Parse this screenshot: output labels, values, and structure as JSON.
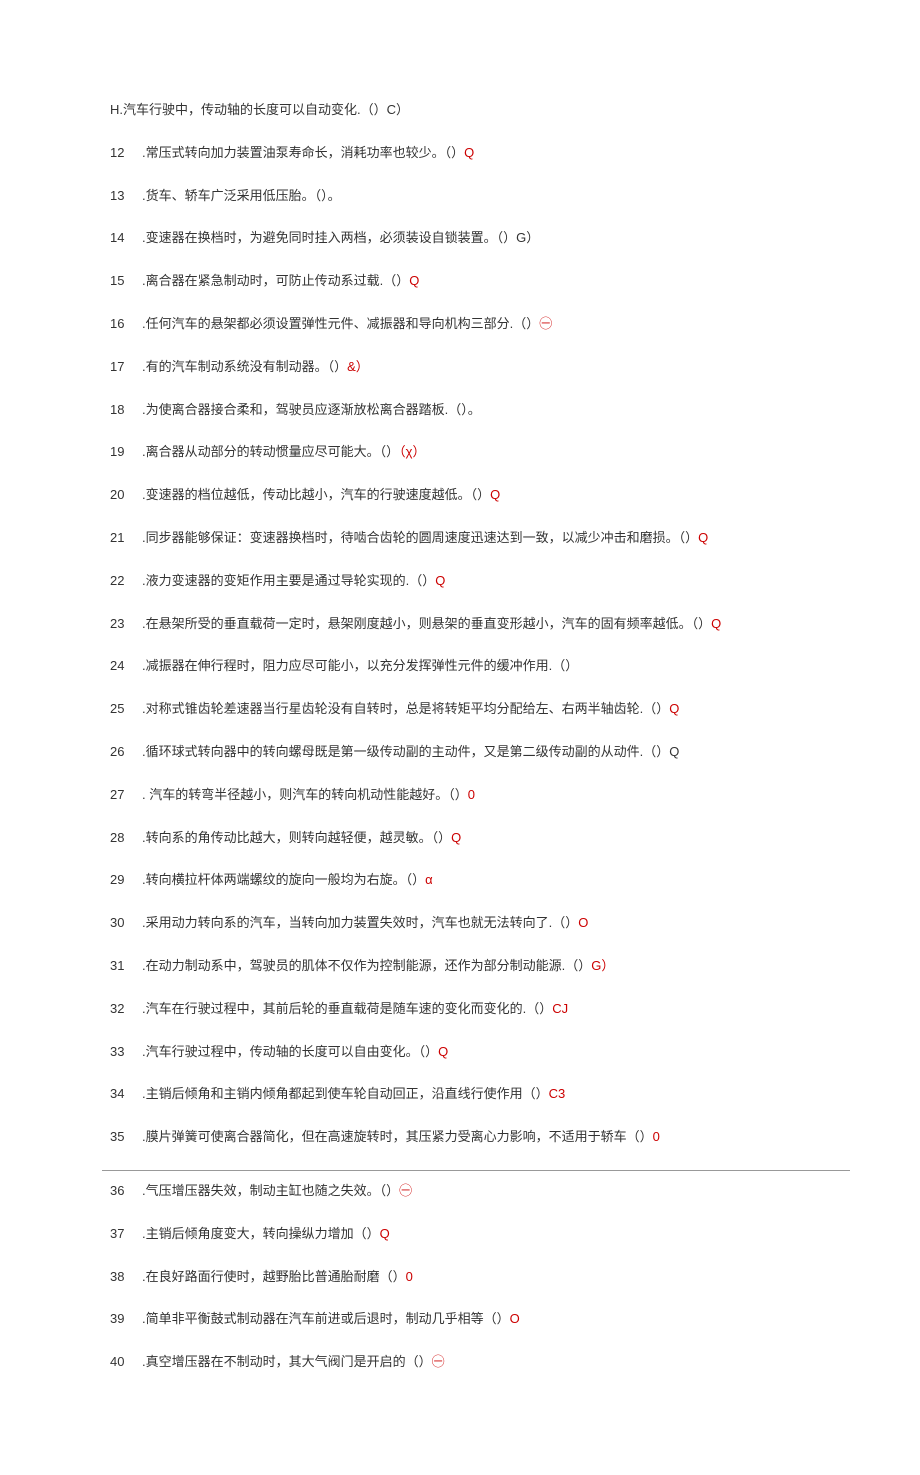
{
  "items": [
    {
      "num": "H",
      "text": ".汽车行驶中，传动轴的长度可以自动变化.（）C）",
      "mark": ""
    },
    {
      "num": "12",
      "text": ".常压式转向加力装置油泵寿命长，消耗功率也较少。（）",
      "mark": "Q"
    },
    {
      "num": "13",
      "text": ".货车、轿车广泛采用低压胎。（）。",
      "mark": ""
    },
    {
      "num": "14",
      "text": ".变速器在换档时，为避免同时挂入两档，必须装设自锁装置。（）G）",
      "mark": ""
    },
    {
      "num": "15",
      "text": ".离合器在紧急制动时，可防止传动系过载.（）",
      "mark": "Q"
    },
    {
      "num": "16",
      "text": ".任何汽车的悬架都必须设置弹性元件、减振器和导向机构三部分.（）",
      "mark": "㊀"
    },
    {
      "num": "17",
      "text": ".有的汽车制动系统没有制动器。（）",
      "mark": "&）"
    },
    {
      "num": "18",
      "text": ".为使离合器接合柔和，驾驶员应逐渐放松离合器踏板.（）。",
      "mark": ""
    },
    {
      "num": "19",
      "text": ".离合器从动部分的转动惯量应尽可能大。（）",
      "mark": "（χ）"
    },
    {
      "num": "20",
      "text": ".变速器的档位越低，传动比越小，汽车的行驶速度越低。（）",
      "mark": "Q"
    },
    {
      "num": "21",
      "text": ".同步器能够保证：变速器换档时，待啮合齿轮的圆周速度迅速达到一致，以减少冲击和磨损。（）",
      "mark": "Q"
    },
    {
      "num": "22",
      "text": ".液力变速器的变矩作用主要是通过导轮实现的.（）",
      "mark": "Q"
    },
    {
      "num": "23",
      "text": ".在悬架所受的垂直载荷一定时，悬架刚度越小，则悬架的垂直变形越小，汽车的固有频率越低。（）",
      "mark": "Q"
    },
    {
      "num": "24",
      "text": ".减振器在伸行程时，阻力应尽可能小，以充分发挥弹性元件的缓冲作用.（）",
      "mark": ""
    },
    {
      "num": "25",
      "text": ".对称式锥齿轮差速器当行星齿轮没有自转时，总是将转矩平均分配给左、右两半轴齿轮.（）",
      "mark": "Q"
    },
    {
      "num": "26",
      "text": ".循环球式转向器中的转向螺母既是第一级传动副的主动件，又是第二级传动副的从动件.（）Q",
      "mark": ""
    },
    {
      "num": "27",
      "text": ". 汽车的转弯半径越小，则汽车的转向机动性能越好。（）",
      "mark": "0"
    },
    {
      "num": "28",
      "text": ".转向系的角传动比越大，则转向越轻便，越灵敏。（）",
      "mark": "Q"
    },
    {
      "num": "29",
      "text": ".转向横拉杆体两端螺纹的旋向一般均为右旋。（）",
      "mark": "α"
    },
    {
      "num": "30",
      "text": ".采用动力转向系的汽车，当转向加力装置失效时，汽车也就无法转向了.（）",
      "mark": "O"
    },
    {
      "num": "31",
      "text": ".在动力制动系中，驾驶员的肌体不仅作为控制能源，还作为部分制动能源.（）",
      "mark": "G）"
    },
    {
      "num": "32",
      "text": ".汽车在行驶过程中，其前后轮的垂直载荷是随车速的变化而变化的.（）",
      "mark": "CJ"
    },
    {
      "num": "33",
      "text": ".汽车行驶过程中，传动轴的长度可以自由变化。（）",
      "mark": "Q"
    },
    {
      "num": "34",
      "text": ".主销后倾角和主销内倾角都起到使车轮自动回正，沿直线行使作用（）",
      "mark": "C3"
    },
    {
      "num": "35",
      "text": ".膜片弹簧可使离合器简化，但在高速旋转时，其压紧力受离心力影响，不适用于轿车（）",
      "mark": "0"
    },
    {
      "num": "36",
      "text": ".气压增压器失效，制动主缸也随之失效。（）",
      "mark": "㊀"
    },
    {
      "num": "37",
      "text": ".主销后倾角度变大，转向操纵力增加（）",
      "mark": "Q"
    },
    {
      "num": "38",
      "text": ".在良好路面行使时，越野胎比普通胎耐磨（）",
      "mark": "0"
    },
    {
      "num": "39",
      "text": ".简单非平衡鼓式制动器在汽车前进或后退时，制动几乎相等（）",
      "mark": "O"
    },
    {
      "num": "40",
      "text": ".真空增压器在不制动时，其大气阀门是开启的（）",
      "mark": "㊀"
    }
  ],
  "dividerAfterIndex": 24
}
